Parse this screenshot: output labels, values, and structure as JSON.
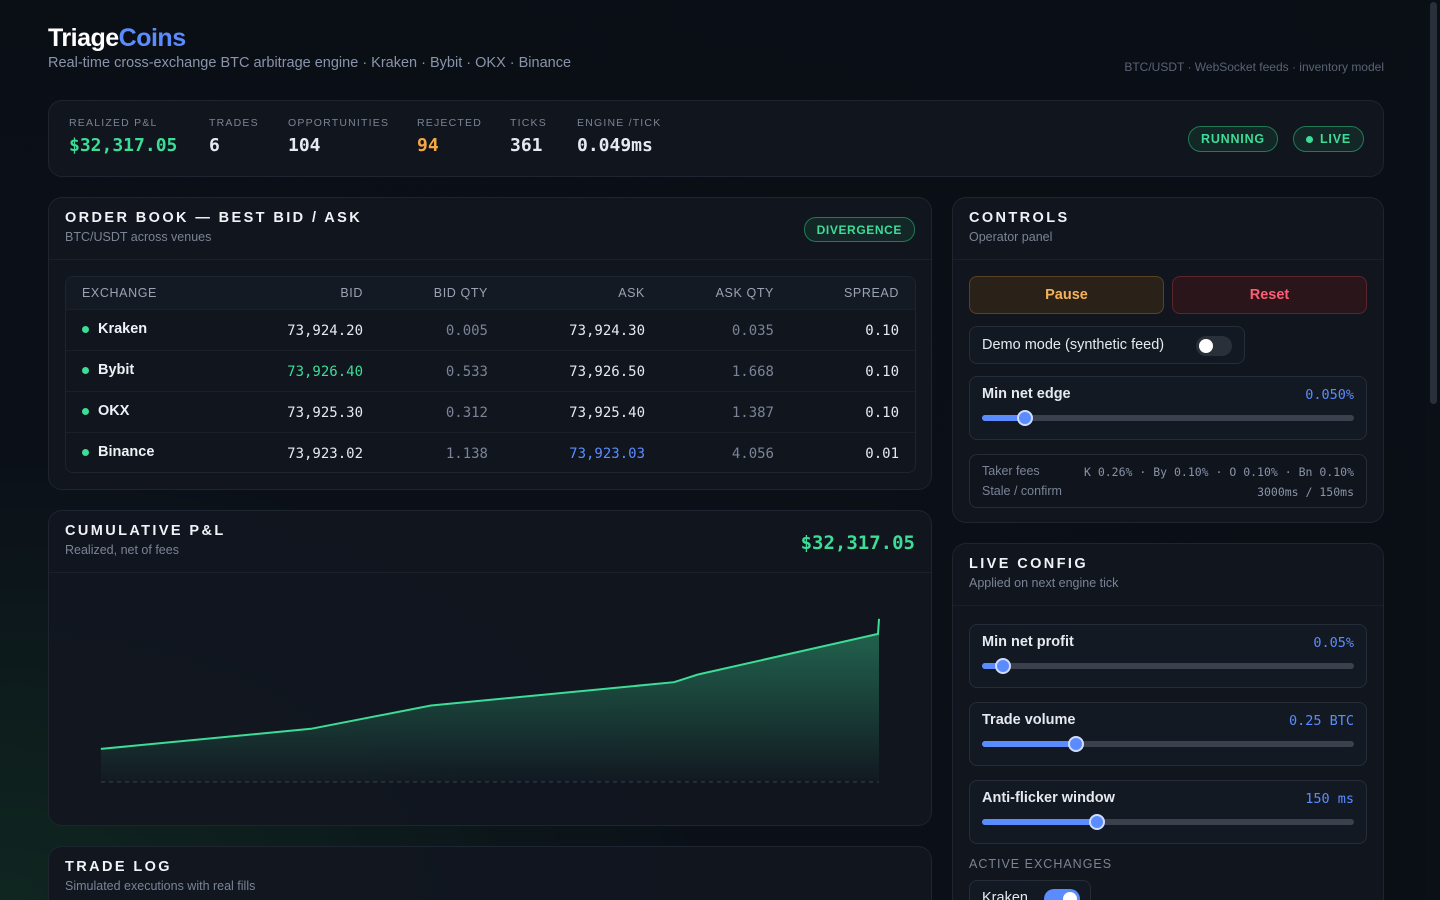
{
  "header": {
    "brand_part1": "Triage",
    "brand_part2": "Coins",
    "tagline": "Real-time cross-exchange BTC arbitrage engine · Kraken · Bybit · OKX · Binance",
    "meta": "BTC/USDT · WebSocket feeds · inventory model"
  },
  "stats": {
    "realized_pnl_label": "REALIZED P&L",
    "realized_pnl": "$32,317.05",
    "trades_label": "TRADES",
    "trades": "6",
    "opportunities_label": "OPPORTUNITIES",
    "opportunities": "104",
    "rejected_label": "REJECTED",
    "rejected": "94",
    "ticks_label": "TICKS",
    "ticks": "361",
    "engine_tick_label": "ENGINE /TICK",
    "engine_tick": "0.049ms",
    "status_running": "RUNNING",
    "status_live": "LIVE"
  },
  "orderbook": {
    "title": "ORDER BOOK — BEST BID / ASK",
    "subtitle": "BTC/USDT across venues",
    "badge": "DIVERGENCE",
    "columns": [
      "EXCHANGE",
      "BID",
      "BID QTY",
      "ASK",
      "ASK QTY",
      "SPREAD"
    ],
    "rows": [
      {
        "exchange": "Kraken",
        "bid": "73,924.20",
        "bid_qty": "0.005",
        "ask": "73,924.30",
        "ask_qty": "0.035",
        "spread": "0.10"
      },
      {
        "exchange": "Bybit",
        "bid": "73,926.40",
        "bid_qty": "0.533",
        "ask": "73,926.50",
        "ask_qty": "1.668",
        "spread": "0.10"
      },
      {
        "exchange": "OKX",
        "bid": "73,925.30",
        "bid_qty": "0.312",
        "ask": "73,925.40",
        "ask_qty": "1.387",
        "spread": "0.10"
      },
      {
        "exchange": "Binance",
        "bid": "73,923.02",
        "bid_qty": "1.138",
        "ask": "73,923.03",
        "ask_qty": "4.056",
        "spread": "0.01"
      }
    ]
  },
  "pnl": {
    "title": "CUMULATIVE P&L",
    "subtitle": "Realized, net of fees",
    "total": "$32,317.05"
  },
  "chart_data": {
    "type": "area",
    "title": "CUMULATIVE P&L",
    "xlabel": "",
    "ylabel": "",
    "x": [
      0,
      1,
      2,
      3,
      4,
      5,
      6
    ],
    "values": [
      0,
      5000,
      10800,
      16600,
      18500,
      28600,
      32317.05
    ],
    "ylim": [
      -8000,
      32317.05
    ],
    "grid": false,
    "color": "#3ddc97"
  },
  "tradelog": {
    "title": "TRADE LOG",
    "subtitle": "Simulated executions with real fills"
  },
  "controls": {
    "title": "CONTROLS",
    "subtitle": "Operator panel",
    "pause_label": "Pause",
    "reset_label": "Reset",
    "demo_label": "Demo mode (synthetic feed)",
    "demo_on": false,
    "min_net_edge_label": "Min net edge",
    "min_net_edge_value": "0.050%",
    "min_net_edge_level": 0.115,
    "fees_label": "Taker fees",
    "fees_value": "K 0.26% · By 0.10% · O 0.10% · Bn 0.10%",
    "stale_label": "Stale / confirm",
    "stale_value": "3000ms / 150ms"
  },
  "live_config": {
    "title": "LIVE CONFIG",
    "subtitle": "Applied on next engine tick",
    "min_net_profit_label": "Min net profit",
    "min_net_profit_value": "0.05%",
    "min_net_profit_level": 0.057,
    "trade_volume_label": "Trade volume",
    "trade_volume_value": "0.25 BTC",
    "trade_volume_level": 0.253,
    "anti_flicker_label": "Anti-flicker window",
    "anti_flicker_value": "150 ms",
    "anti_flicker_level": 0.31,
    "active_exchanges_label": "ACTIVE EXCHANGES",
    "first_exchange": "Kraken"
  },
  "colors": {
    "accent_blue": "#5b8cff",
    "positive_green": "#3ddc97",
    "warning_orange": "#f5a742",
    "danger_red": "#ff5d73"
  }
}
